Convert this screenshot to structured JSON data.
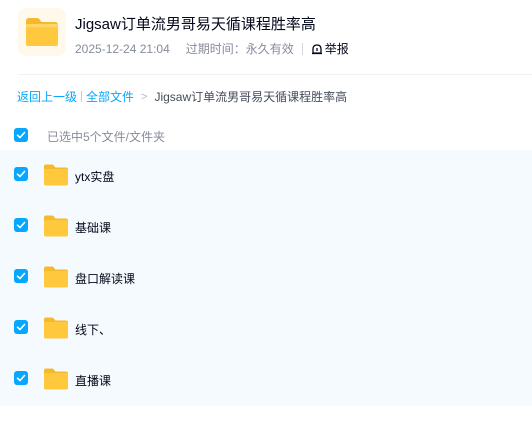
{
  "header": {
    "title": "Jigsaw订单流男哥易天循课程胜率高",
    "datetime": "2025-12-24 21:04",
    "expire_label": "过期时间：永久有效",
    "report_label": "举报"
  },
  "breadcrumb": {
    "back": "返回上一级",
    "all_files": "全部文件",
    "arrow": ">",
    "current": "Jigsaw订单流男哥易天循课程胜率高"
  },
  "selection": {
    "label": "已选中5个文件/文件夹",
    "checked": true
  },
  "files": [
    {
      "name": "ytx实盘",
      "checked": true,
      "icon": "folder-icon"
    },
    {
      "name": "基础课",
      "checked": true,
      "icon": "folder-icon"
    },
    {
      "name": "盘口解读课",
      "checked": true,
      "icon": "folder-icon"
    },
    {
      "name": "线下、",
      "checked": true,
      "icon": "folder-icon"
    },
    {
      "name": "直播课",
      "checked": true,
      "icon": "folder-icon"
    }
  ],
  "colors": {
    "accent": "#06a7ff",
    "folder": "#ffc83d",
    "list_bg": "#f5fafe"
  }
}
